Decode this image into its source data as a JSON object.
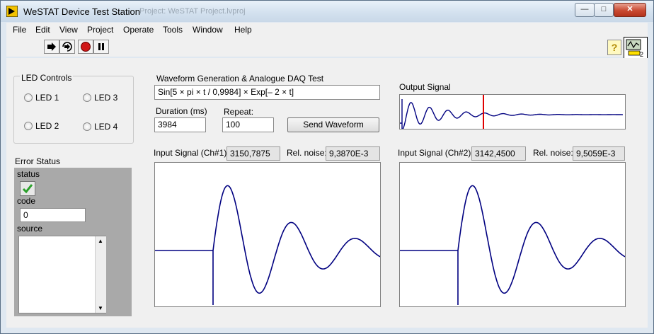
{
  "window": {
    "title": "WeSTAT Device Test Station",
    "background_title": "Project: WeSTAT Project.lvproj",
    "buttons": {
      "minimize": "—",
      "maximize": "□",
      "close": "✕"
    }
  },
  "menu": [
    {
      "id": "file",
      "label": "File"
    },
    {
      "id": "edit",
      "label": "Edit"
    },
    {
      "id": "view",
      "label": "View"
    },
    {
      "id": "project",
      "label": "Project"
    },
    {
      "id": "operate",
      "label": "Operate"
    },
    {
      "id": "tools",
      "label": "Tools"
    },
    {
      "id": "window",
      "label": "Window"
    },
    {
      "id": "help",
      "label": "Help"
    }
  ],
  "toolbar": {
    "icons": [
      "run-arrow-icon",
      "run-continuously-icon",
      "abort-icon",
      "pause-icon"
    ],
    "help_label": "?",
    "vi_icon_number": "2"
  },
  "led_controls": {
    "title": "LED Controls",
    "leds": [
      "LED 1",
      "LED 3",
      "LED 2",
      "LED 4"
    ]
  },
  "error_status": {
    "title": "Error Status",
    "status_label": "status",
    "code_label": "code",
    "code_value": "0",
    "source_label": "source",
    "source_value": ""
  },
  "waveform": {
    "title": "Waveform Generation & Analogue DAQ Test",
    "expression": "Sin[5 × pi × t / 0,9984] × Exp[– 2 × t]",
    "duration_label": "Duration (ms)",
    "duration_value": "3984",
    "repeat_label": "Repeat:",
    "repeat_value": "100",
    "send_button": "Send Waveform"
  },
  "output_signal": {
    "title": "Output Signal",
    "marker_color": "#e00000",
    "trace_color": "#000080"
  },
  "input_ch1": {
    "label": "Input Signal (Ch#1)",
    "value": "3150,7875",
    "noise_label": "Rel. noise:",
    "noise_value": "9,3870E-3"
  },
  "input_ch2": {
    "label": "Input Signal (Ch#2)",
    "value": "3142,4500",
    "noise_label": "Rel. noise:",
    "noise_value": "9,5059E-3"
  },
  "colors": {
    "trace": "#000080",
    "error_cluster": "#a9a9a9",
    "status_ok": "#2aa02a"
  }
}
